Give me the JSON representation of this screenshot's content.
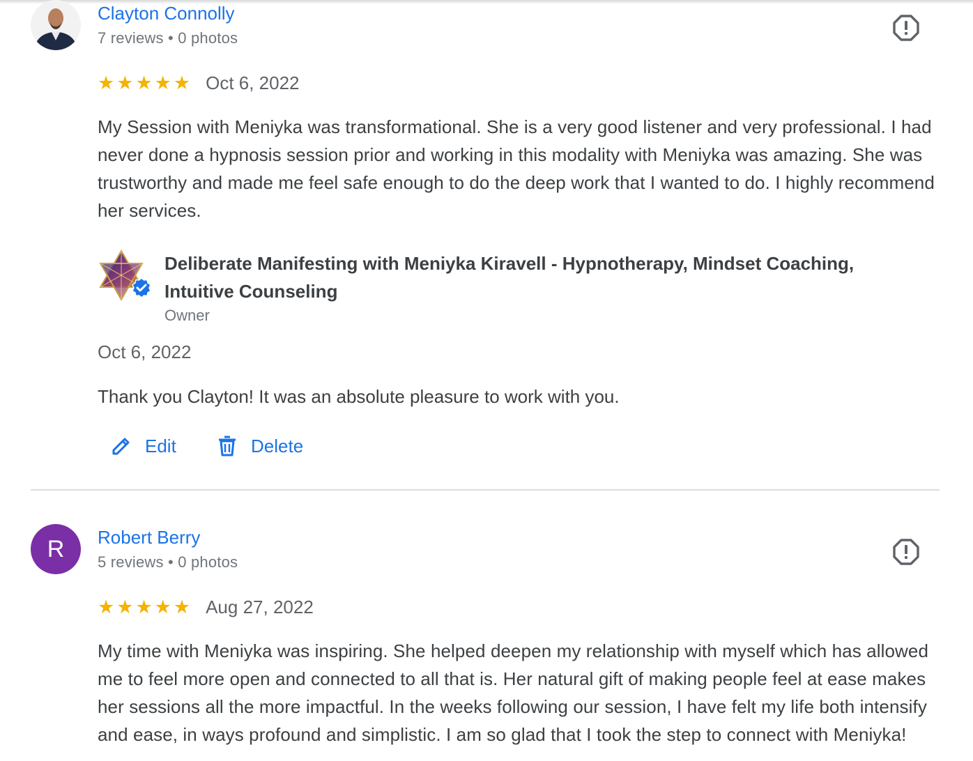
{
  "reviews": [
    {
      "reviewer_name": "Clayton Connolly",
      "reviewer_meta": "7 reviews • 0 photos",
      "rating": 5,
      "date": "Oct 6, 2022",
      "text": "My Session with Meniyka was transformational. She is a very good listener and very professional. I had never done a hypnosis session prior and working in this modality with Meniyka was amazing. She was trustworthy and made me feel safe enough to do the deep work that I wanted to do. I highly recommend her services.",
      "owner_reply": {
        "business_name": "Deliberate Manifesting with Meniyka Kiravell - Hypnotherapy, Mindset Coaching, Intuitive Counseling",
        "role": "Owner",
        "date": "Oct 6, 2022",
        "text": "Thank you Clayton! It was an absolute pleasure to work with you.",
        "edit_label": "Edit",
        "delete_label": "Delete"
      }
    },
    {
      "reviewer_name": "Robert Berry",
      "avatar_letter": "R",
      "reviewer_meta": "5 reviews • 0 photos",
      "rating": 5,
      "date": "Aug 27, 2022",
      "text": "My time with Meniyka was inspiring. She helped deepen my relationship with myself which has allowed me to feel more open and connected to all that is. Her natural gift of making people feel at ease makes her sessions all the more impactful. In the weeks following our session, I have felt my life both intensify and ease, in ways profound and simplistic. I am so glad that I took the step to connect with Meniyka!"
    }
  ],
  "icons": {
    "star": "star-icon",
    "flag": "report-icon",
    "edit": "pencil-icon",
    "delete": "trash-icon",
    "verified": "verified-badge-icon"
  },
  "colors": {
    "accent": "#1a73e8",
    "star": "#f4b400",
    "avatar_r": "#7b2fa6"
  }
}
